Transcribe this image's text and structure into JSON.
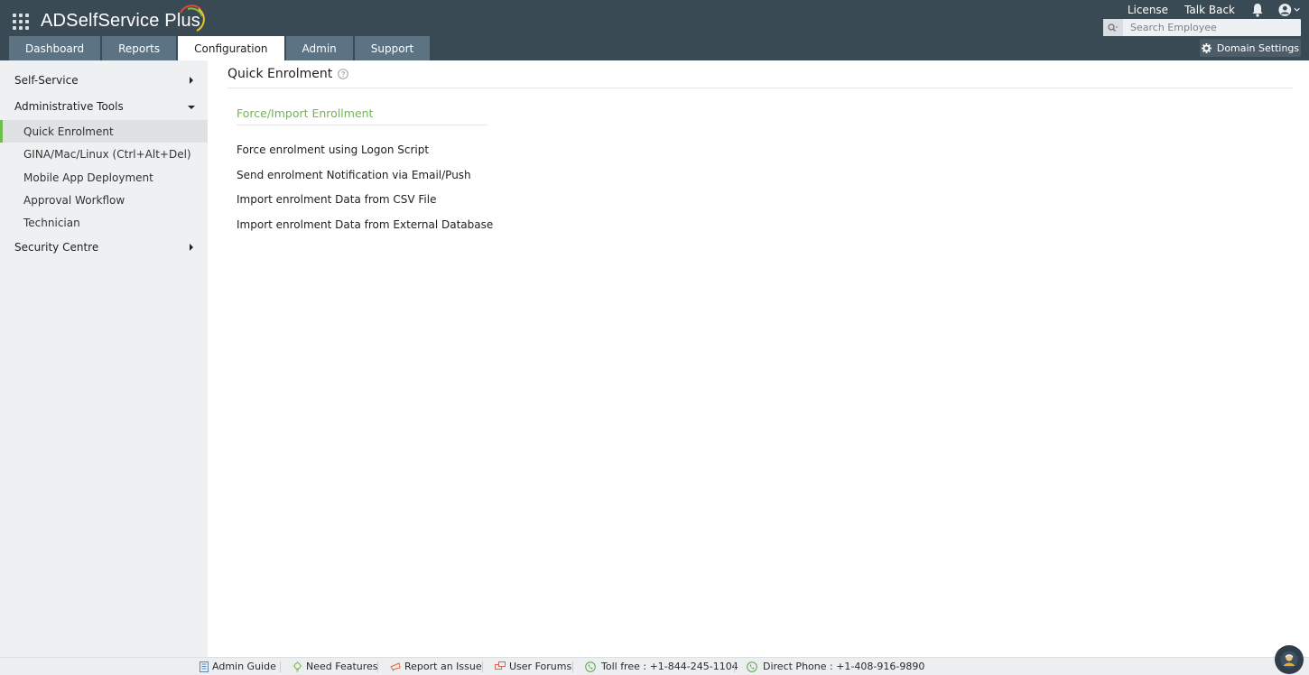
{
  "header": {
    "app_title": "ADSelfService Plus",
    "top_links": {
      "license": "License",
      "talk_back": "Talk Back"
    },
    "search": {
      "placeholder": "Search Employee"
    },
    "domain_settings": "Domain Settings"
  },
  "tabs": [
    {
      "label": "Dashboard"
    },
    {
      "label": "Reports"
    },
    {
      "label": "Configuration",
      "active": true
    },
    {
      "label": "Admin"
    },
    {
      "label": "Support"
    }
  ],
  "sidebar": {
    "self_service": "Self-Service",
    "administrative_tools": "Administrative Tools",
    "items": [
      {
        "label": "Quick Enrolment",
        "active": true
      },
      {
        "label": "GINA/Mac/Linux (Ctrl+Alt+Del)"
      },
      {
        "label": "Mobile App Deployment"
      },
      {
        "label": "Approval Workflow"
      },
      {
        "label": "Technician"
      }
    ],
    "security_centre": "Security Centre"
  },
  "main": {
    "title": "Quick Enrolment",
    "section_title": "Force/Import Enrollment",
    "actions": [
      "Force enrolment using Logon Script",
      "Send enrolment Notification via Email/Push",
      "Import enrolment Data from CSV File",
      "Import enrolment Data from External Database"
    ]
  },
  "footer": {
    "admin_guide": "Admin Guide",
    "need_features": "Need Features",
    "report_issue": "Report an Issue",
    "user_forums": "User Forums",
    "toll_free": "Toll free : +1-844-245-1104",
    "direct_phone": "Direct Phone : +1-408-916-9890"
  },
  "colors": {
    "header_bg": "#3a4a55",
    "tab_bg": "#5b7382",
    "accent_green": "#6db84a",
    "sidebar_bg": "#eef0f2"
  }
}
